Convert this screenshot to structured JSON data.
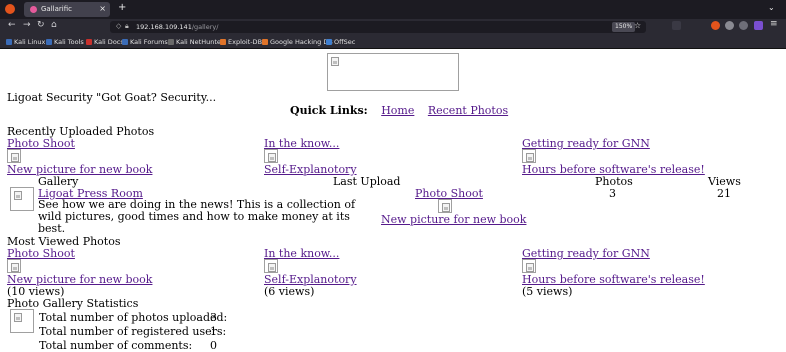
{
  "browser": {
    "tab_title": "Gallarific",
    "tab_close": "×",
    "new_tab": "+",
    "url_host": "192.168.109.141",
    "url_path": "/gallery/",
    "zoom": "150%",
    "bookmarks": [
      "Kali Linux",
      "Kali Tools",
      "Kali Docs",
      "Kali Forums",
      "Kali NetHunter",
      "Exploit-DB",
      "Google Hacking DB",
      "OffSec"
    ],
    "bookmark_colors": [
      "#3b6cb7",
      "#3b6cb7",
      "#c8312d",
      "#3b6cb7",
      "#6a6a6a",
      "#e0742a",
      "#e0742a",
      "#3f7fd0"
    ]
  },
  "page": {
    "site_title": "Ligoat Security \"Got Goat? Security...",
    "quick_links_label": "Quick Links:",
    "quick_links": [
      "Home",
      "Recent Photos"
    ],
    "recent_heading": "Recently Uploaded Photos",
    "recent": [
      {
        "title": "Photo Shoot",
        "caption": "New picture for new book"
      },
      {
        "title": "In the know...",
        "caption": "Self-Explanotory"
      },
      {
        "title": "Getting ready for GNN",
        "caption": "Hours before software's release!"
      }
    ],
    "gallery_table": {
      "headers": [
        "Gallery",
        "Last Upload",
        "Photos",
        "Views"
      ],
      "row": {
        "name": "Ligoat Press Room",
        "description_lines": [
          "See how we are doing in the news! This is a collection of",
          "wild pictures, good times and how to make money at its",
          "best."
        ],
        "last_upload_title": "Photo Shoot",
        "last_upload_caption": "New picture for new book",
        "photos": "3",
        "views": "21"
      }
    },
    "most_viewed_heading": "Most Viewed Photos",
    "most_viewed": [
      {
        "title": "Photo Shoot",
        "caption": "New picture for new book",
        "views": "(10 views)"
      },
      {
        "title": "In the know...",
        "caption": "Self-Explanotory",
        "views": "(6 views)"
      },
      {
        "title": "Getting ready for GNN",
        "caption": "Hours before software's release!",
        "views": "(5 views)"
      }
    ],
    "stats_heading": "Photo Gallery Statistics",
    "stats": [
      {
        "label": "Total number of photos uploaded:",
        "value": "3"
      },
      {
        "label": "Total number of registered users:",
        "value": "1"
      },
      {
        "label": "Total number of comments:",
        "value": "0"
      }
    ]
  }
}
